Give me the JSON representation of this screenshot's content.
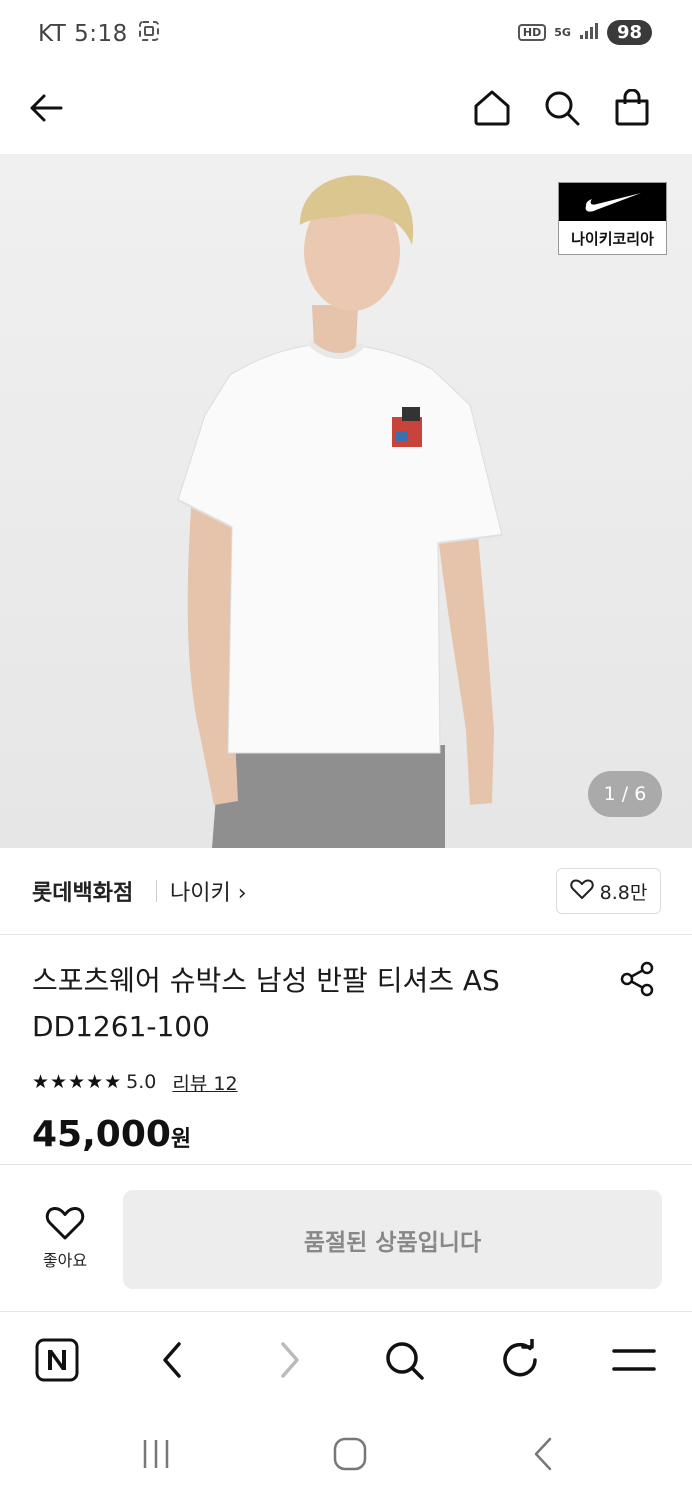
{
  "status_bar": {
    "carrier_time": "KT 5:18",
    "hd": "HD",
    "network": "5G",
    "battery": "98"
  },
  "top_nav": {
    "icons": [
      "back-arrow-icon",
      "home-icon",
      "search-icon",
      "shopping-bag-icon"
    ]
  },
  "product_image": {
    "brand_badge_text": "나이키코리아",
    "counter": "1 / 6"
  },
  "store": {
    "name": "롯데백화점",
    "brand": "나이키 ›",
    "like_count": "8.8만"
  },
  "product": {
    "title": "스포츠웨어 슈박스 남성 반팔 티셔츠 AS DD1261-100",
    "stars": "★★★★★",
    "rating": "5.0",
    "review_link": "리뷰 12",
    "price": "45,000",
    "price_unit": "원"
  },
  "actions": {
    "wish_label": "좋아요",
    "soldout_label": "품절된 상품입니다"
  },
  "browser_bar": {
    "icons": [
      "naver-n-icon",
      "back-chevron-icon",
      "forward-chevron-icon",
      "search-icon",
      "refresh-icon",
      "menu-icon"
    ]
  },
  "system_nav": {
    "icons": [
      "recent-apps-icon",
      "home-circle-icon",
      "back-icon"
    ]
  },
  "colors": {
    "image_bg": "#ededed",
    "soldout_bg": "#ededed",
    "soldout_text": "#888888",
    "text": "#1a1a1a"
  }
}
